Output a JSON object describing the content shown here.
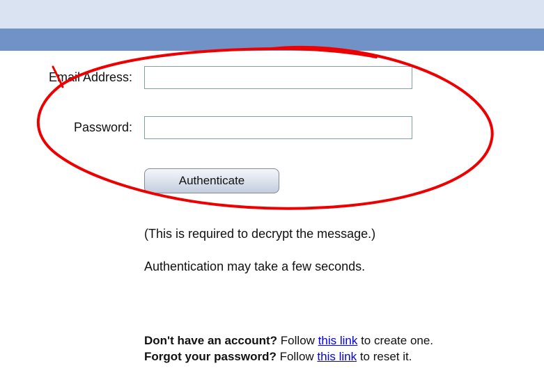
{
  "form": {
    "email_label": "Email Address:",
    "email_value": "",
    "password_label": "Password:",
    "password_value": "",
    "submit_label": "Authenticate"
  },
  "notes": {
    "required": "(This is required to decrypt the message.)",
    "timing": "Authentication may take a few seconds."
  },
  "account": {
    "signup_bold": "Don't have an account?",
    "signup_pre": " Follow ",
    "signup_link": "this link",
    "signup_post": " to create one.",
    "forgot_bold": "Forgot your password?",
    "forgot_pre": " Follow ",
    "forgot_link": "this link",
    "forgot_post": " to reset it."
  },
  "colors": {
    "header_band_light": "#d9e3f2",
    "header_band_blue": "#7092c6",
    "annotation_circle": "#ee0000",
    "link": "#0000ee"
  }
}
